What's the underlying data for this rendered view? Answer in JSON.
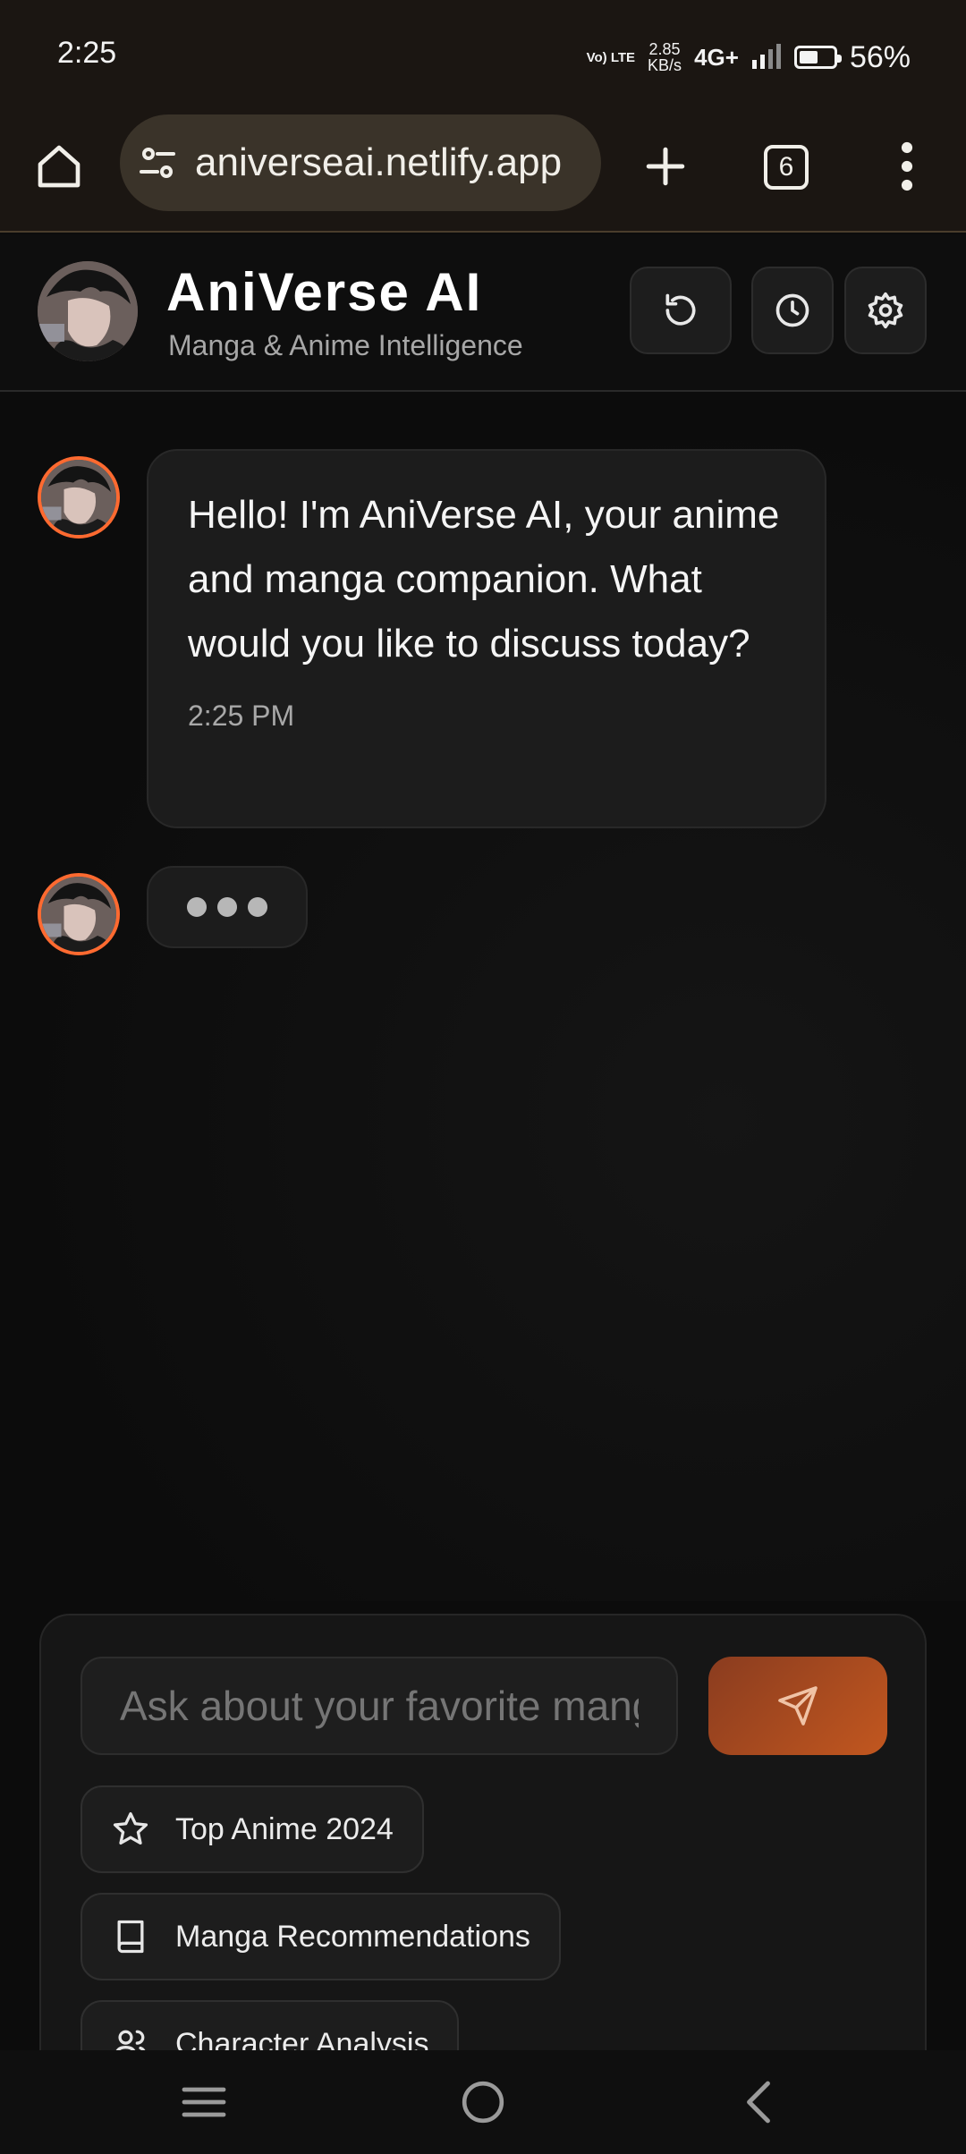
{
  "status_bar": {
    "time": "2:25",
    "volte": "Vo) LTE",
    "network_speed_value": "2.85",
    "network_speed_unit": "KB/s",
    "network_type": "4G+",
    "battery_percent": "56%",
    "battery_level": 0.56
  },
  "browser": {
    "url": "aniverseai.netlify.app",
    "tab_count": "6",
    "icons": [
      "home-icon",
      "site-settings-icon",
      "plus-icon",
      "tabs-icon",
      "kebab-menu-icon"
    ]
  },
  "app_header": {
    "title": "AniVerse AI",
    "subtitle": "Manga & Anime Intelligence",
    "actions": [
      "reset-icon",
      "history-clock-icon",
      "settings-gear-icon"
    ]
  },
  "chat": {
    "messages": [
      {
        "sender": "bot",
        "text": "Hello! I'm AniVerse AI, your anime and manga companion. What would you like to discuss today?",
        "time": "2:25 PM"
      }
    ]
  },
  "composer": {
    "placeholder": "Ask about your favorite manga, anime, or characters...",
    "suggestions": [
      {
        "label": "Top Anime 2024",
        "icon": "star-icon"
      },
      {
        "label": "Manga Recommendations",
        "icon": "book-icon"
      },
      {
        "label": "Character Analysis",
        "icon": "users-icon"
      }
    ]
  },
  "colors": {
    "accent": "#ff6a30",
    "send_button": "#b0501f",
    "background": "#0c0c0c",
    "bubble": "#1c1c1c",
    "browser_chrome": "#1b1612"
  }
}
